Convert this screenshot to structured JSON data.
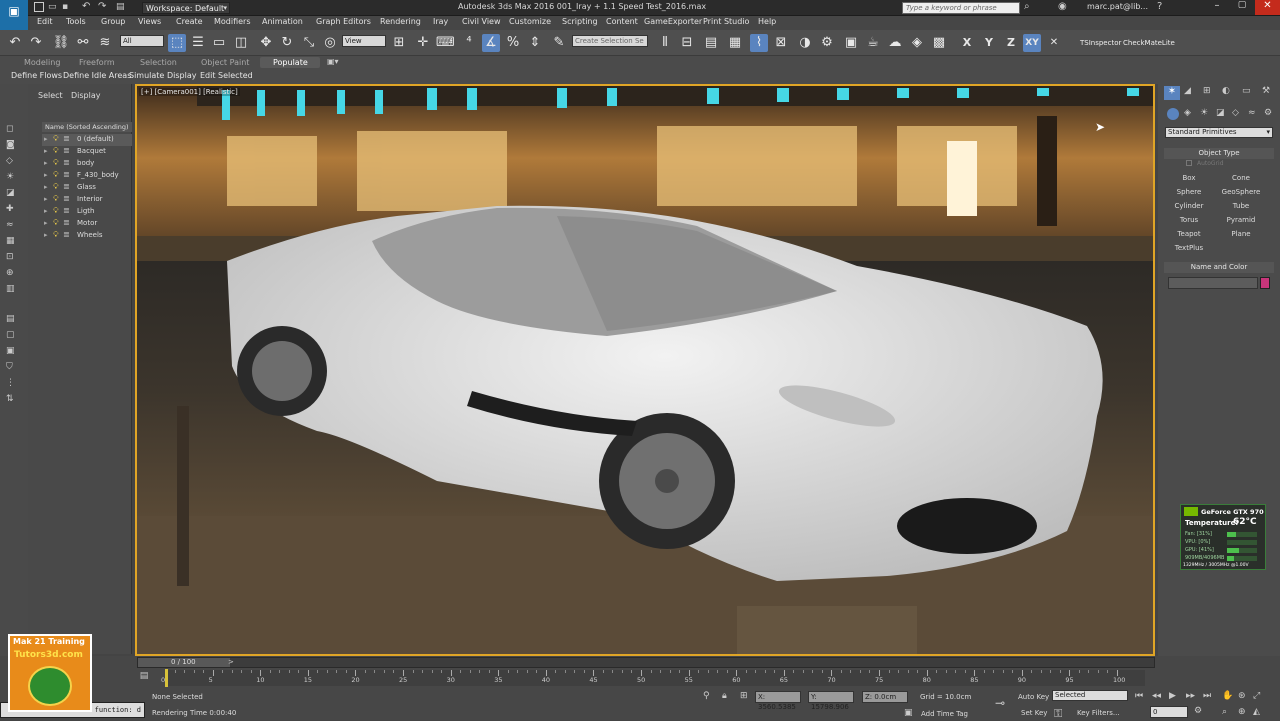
{
  "titlebar": {
    "workspace": "Workspace: Default",
    "title": "Autodesk 3ds Max 2016     001_Iray + 1.1 Speed Test_2016.max",
    "search_placeholder": "Type a keyword or phrase",
    "user": "marc.pat@lib..."
  },
  "menu": [
    "Edit",
    "Tools",
    "Group",
    "Views",
    "Create",
    "Modifiers",
    "Animation",
    "Graph Editors",
    "Rendering",
    "Iray",
    "Civil View",
    "Customize",
    "Scripting",
    "Content",
    "GameExporter",
    "Print Studio",
    "Help"
  ],
  "toolbar": {
    "filter": "All",
    "refcoord": "View",
    "selection_set": "Create Selection Se",
    "xyz": [
      "X",
      "Y",
      "Z",
      "XY"
    ],
    "plugins": [
      "TSInspector",
      "CheckMateLite"
    ]
  },
  "ribbon": {
    "tabs": [
      "Modeling",
      "Freeform",
      "Selection",
      "Object Paint",
      "Populate"
    ],
    "subtabs": [
      "Define Flows",
      "Define Idle Areas",
      "Simulate",
      "Display",
      "Edit Selected"
    ]
  },
  "explorer": {
    "tabs": [
      "Select",
      "Display"
    ],
    "header": "Name (Sorted Ascending)",
    "items": [
      "0 (default)",
      "Bacquet",
      "body",
      "F_430_body",
      "Glass",
      "Interior",
      "Ligth",
      "Motor",
      "Wheels"
    ]
  },
  "viewport": {
    "label": "[+] [Camera001] [Realistic]"
  },
  "cmdpanel": {
    "category": "Standard Primitives",
    "object_type": "Object Type",
    "autogrid": "AutoGrid",
    "primitives": [
      "Box",
      "Cone",
      "Sphere",
      "GeoSphere",
      "Cylinder",
      "Tube",
      "Torus",
      "Pyramid",
      "Teapot",
      "Plane",
      "TextPlus"
    ],
    "name_color": "Name and Color",
    "swatch_color": "#c8357a"
  },
  "gpu": {
    "name": "GeForce GTX 970",
    "temp_label": "Temperature:",
    "temp": "62°C",
    "fan": "Fan: [31%]",
    "vpu": "VPU: [0%]",
    "gpu": "GPU: [41%]",
    "mem": "909MB/4096MB",
    "clock": "1329MHz / 3005MHz @1.00V"
  },
  "timeline": {
    "frame": "0 / 100",
    "ticks": [
      "0",
      "5",
      "10",
      "15",
      "20",
      "25",
      "30",
      "35",
      "40",
      "45",
      "50",
      "55",
      "60",
      "65",
      "70",
      "75",
      "80",
      "85",
      "90",
      "95",
      "100"
    ]
  },
  "status": {
    "selection": "None Selected",
    "render_time": "Rendering Time  0:00:40",
    "x": "X: 3560.5385",
    "y": "Y: 15798.906",
    "z": "Z: 0.0cm",
    "grid": "Grid = 10.0cm",
    "add_time_tag": "Add Time Tag",
    "auto_key": "Auto Key",
    "set_key": "Set Key",
    "key_mode": "Selected",
    "key_filters": "Key Filters...",
    "maxscript": "function: d",
    "frame_field": "0"
  },
  "watermark": {
    "line1": "Mak 21 Training",
    "line2": "Tutors3d.com"
  }
}
